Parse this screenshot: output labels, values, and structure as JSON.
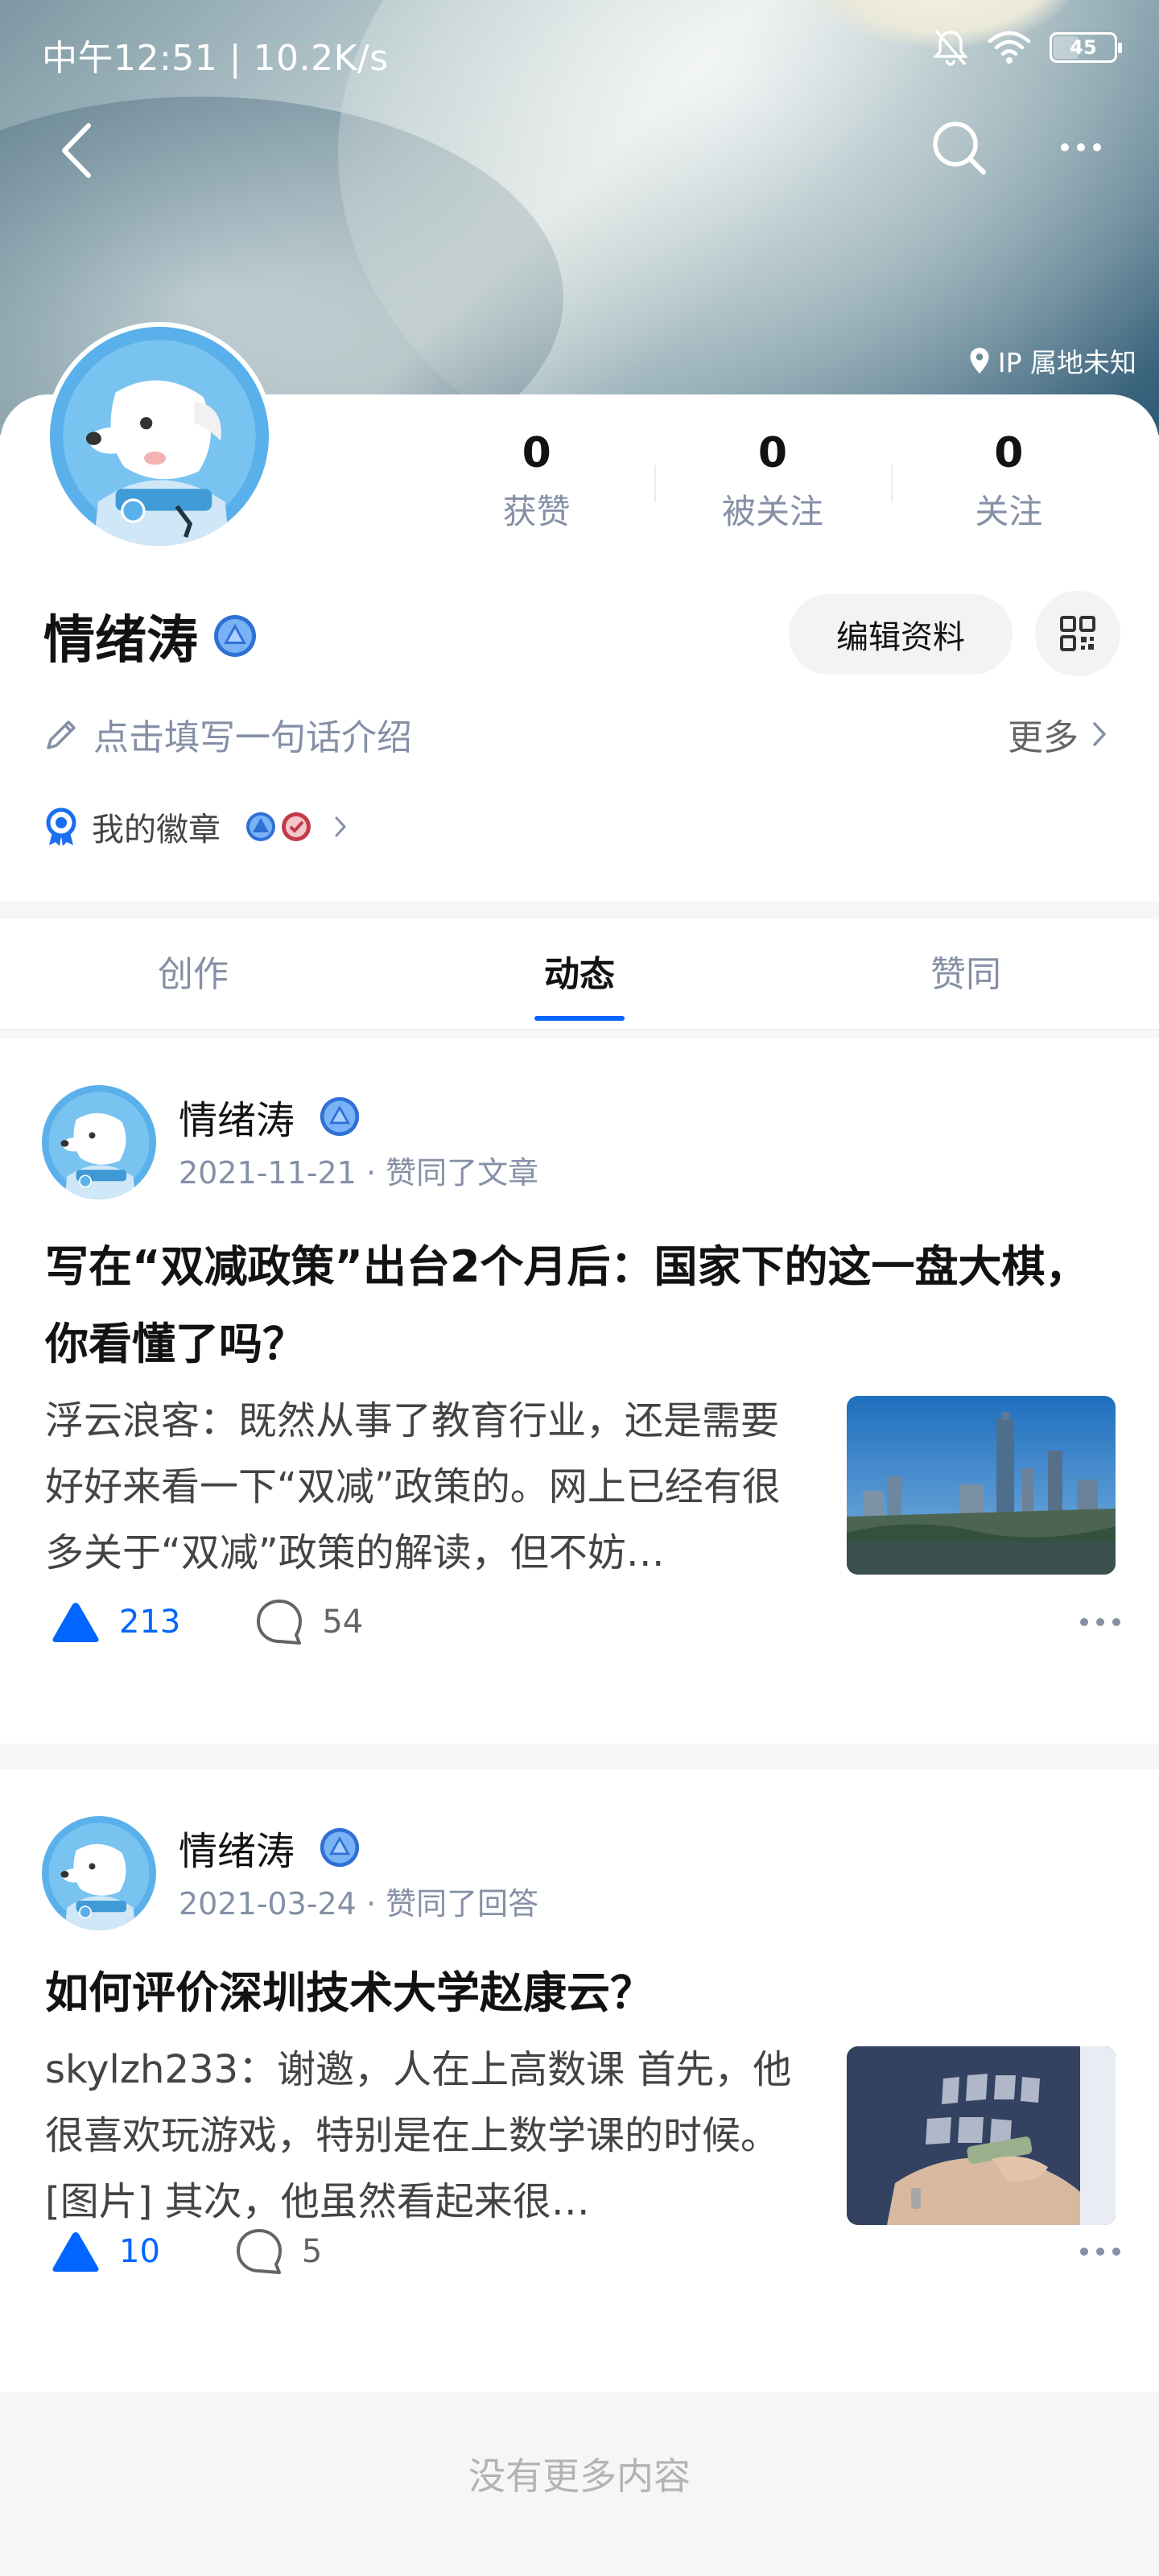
{
  "status_bar": {
    "time": "中午12:51 | 10.2K/s",
    "battery": "45"
  },
  "header": {
    "ip_location": "IP 属地未知"
  },
  "profile": {
    "name": "情绪涛",
    "stats": [
      {
        "value": "0",
        "label": "获赞"
      },
      {
        "value": "0",
        "label": "被关注"
      },
      {
        "value": "0",
        "label": "关注"
      }
    ],
    "edit_button": "编辑资料",
    "bio_placeholder": "点击填写一句话介绍",
    "more_label": "更多",
    "badges_label": "我的徽章"
  },
  "tabs": [
    {
      "label": "创作",
      "active": false
    },
    {
      "label": "动态",
      "active": true
    },
    {
      "label": "赞同",
      "active": false
    }
  ],
  "feed": [
    {
      "name": "情绪涛",
      "date": "2021-11-21",
      "action": "赞同了文章",
      "title": "写在“双减政策”出台2个月后：国家下的这一盘大棋，你看懂了吗？",
      "excerpt_author": "浮云浪客",
      "excerpt": "：既然从事了教育行业，还是需要好好来看一下“双减”政策的。网上已经有很多关于“双减”政策的解读，但不妨…",
      "votes": "213",
      "comments": "54"
    },
    {
      "name": "情绪涛",
      "date": "2021-03-24",
      "action": "赞同了回答",
      "title": "如何评价深圳技术大学赵康云？",
      "excerpt_author": "skylzh233",
      "excerpt": "：谢邀，人在上高数课 首先，他很喜欢玩游戏，特别是在上数学课的时候。 [图片] 其次，他虽然看起来很…",
      "votes": "10",
      "comments": "5"
    }
  ],
  "footer": {
    "no_more": "没有更多内容"
  },
  "colors": {
    "accent": "#0066ff",
    "secondary_text": "#8590a6"
  }
}
